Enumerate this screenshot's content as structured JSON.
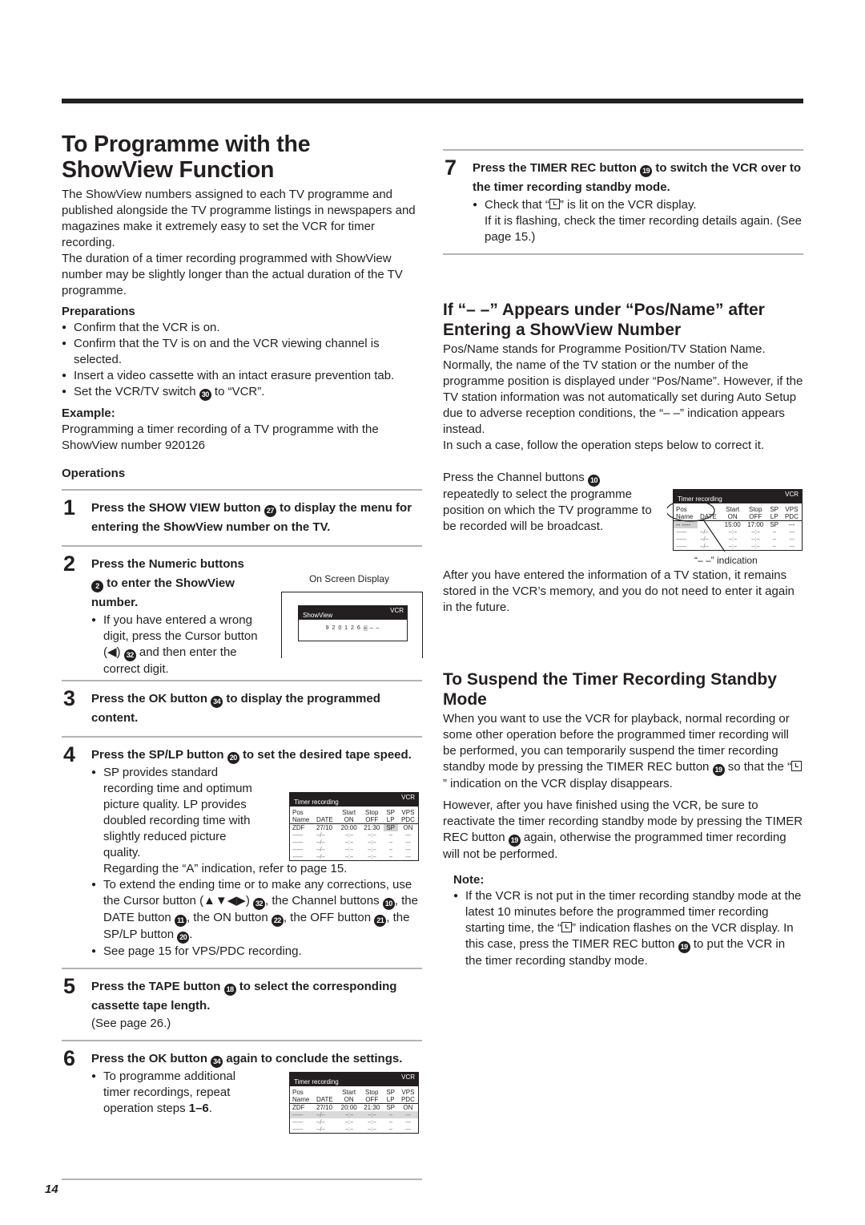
{
  "page_number": "14",
  "left": {
    "title_line1": "To Programme with the",
    "title_line2": "ShowView Function",
    "intro1": "The ShowView numbers assigned to each TV programme and published alongside the TV programme listings in newspapers and magazines make it extremely easy to set the VCR for timer recording.",
    "intro2": "The duration of a timer recording programmed with ShowView number may be slightly longer than the actual duration of the TV programme.",
    "preparations_heading": "Preparations",
    "preparations": [
      "Confirm that the VCR is on.",
      "Confirm that the TV is on and the VCR viewing channel is selected.",
      "Insert a video cassette with an intact erasure prevention tab.",
      "Set the VCR/TV switch",
      "to “VCR”."
    ],
    "prep_switch_ref": "30",
    "example_heading": "Example:",
    "example_text": "Programming a timer recording of a TV programme with the ShowView number 920126",
    "operations_heading": "Operations",
    "steps": [
      {
        "num": "1",
        "a": "Press the SHOW VIEW button",
        "ref": "27",
        "b": "to display the menu for entering the ShowView number on the TV."
      },
      {
        "num": "2",
        "a": "Press the Numeric buttons",
        "ref": "2",
        "b": "to enter the ShowView number.",
        "bullet_a": "If you have entered a wrong digit, press the Cursor button (◀)",
        "bullet_ref": "32",
        "bullet_b": "and then enter the correct digit."
      },
      {
        "num": "3",
        "a": "Press the OK button",
        "ref": "34",
        "b": "to display the programmed content."
      },
      {
        "num": "4",
        "a": "Press the SP/LP button",
        "ref": "20",
        "b": "to set the desired tape speed.",
        "bullet1": "SP provides standard recording time and optimum picture quality. LP provides doubled recording time with slightly reduced picture quality.",
        "bullet1_extra": "Regarding the “A” indication, refer to page 15.",
        "bullet2_parts": [
          "To extend the ending time or to make any corrections, use the Cursor button (▲▼◀▶)",
          ", the Channel buttons",
          ", the DATE button",
          ", the ON button",
          ", the OFF button",
          ", the SP/LP button",
          "."
        ],
        "bullet2_refs": [
          "32",
          "10",
          "11",
          "22",
          "21",
          "20"
        ],
        "bullet3": "See page 15 for VPS/PDC recording."
      },
      {
        "num": "5",
        "a": "Press the TAPE button",
        "ref": "18",
        "b": "to select the corresponding cassette tape length.",
        "extra": "(See page 26.)"
      },
      {
        "num": "6",
        "a": "Press the OK button",
        "ref": "34",
        "b": "again to conclude the settings.",
        "bullet_a": "To programme additional timer recordings, repeat operation steps",
        "bullet_bold": "1–6",
        "bullet_b": "."
      }
    ]
  },
  "osd_showview": {
    "caption": "On Screen Display",
    "title": "ShowView",
    "source": "VCR",
    "digits": "9 2 0 1 2 6",
    "cursor": "–",
    "rest": "– –"
  },
  "timer_table_header": {
    "title": "Timer recording",
    "source": "VCR",
    "head1": [
      "Pos",
      "",
      "Start",
      "Stop",
      "SP",
      "VPS"
    ],
    "head2": [
      "Name",
      "DATE",
      "ON",
      "OFF",
      "LP",
      "PDC"
    ]
  },
  "timer_table_step4": {
    "rows": [
      [
        "ZDF",
        "27/10",
        "20:00",
        "21:30",
        "SP",
        "ON"
      ],
      [
        "------",
        "--/--",
        "--:--",
        "--:--",
        "--",
        "---"
      ],
      [
        "------",
        "--/--",
        "--:--",
        "--:--",
        "--",
        "---"
      ],
      [
        "------",
        "--/--",
        "--:--",
        "--:--",
        "--",
        "---"
      ],
      [
        "------",
        "--/--",
        "--:--",
        "--:--",
        "--",
        "---"
      ]
    ]
  },
  "timer_table_step6": {
    "rows": [
      [
        "ZDF",
        "27/10",
        "20:00",
        "21:30",
        "SP",
        "ON"
      ],
      [
        "------",
        "--/--",
        "--:--",
        "--:--",
        "--",
        "---"
      ],
      [
        "------",
        "--/--",
        "--:--",
        "--:--",
        "--",
        "---"
      ],
      [
        "------",
        "--/--",
        "--:--",
        "--:--",
        "--",
        "---"
      ]
    ]
  },
  "timer_table_posname": {
    "rows": [
      [
        "-- ----",
        "",
        "15:00",
        "17:00",
        "SP",
        "---"
      ],
      [
        "------",
        "--/--",
        "--:--",
        "--:--",
        "--",
        "---"
      ],
      [
        "------",
        "--/--",
        "--:--",
        "--:--",
        "--",
        "---"
      ],
      [
        "------",
        "--/--",
        "--:--",
        "--:--",
        "--",
        "---"
      ]
    ],
    "callout": "“– –” indication"
  },
  "right": {
    "step7": {
      "num": "7",
      "a": "Press the TIMER REC button",
      "ref": "19",
      "b": "to switch the VCR over to the timer recording standby mode.",
      "bullet_a": "Check that “",
      "bullet_b": "” is lit on the VCR display.",
      "bullet_extra": "If it is flashing, check the timer recording details again. (See page 15.)"
    },
    "posname_heading": "If “– –” Appears under “Pos/Name” after Entering a ShowView Number",
    "posname_body": "Pos/Name stands for Programme Position/TV Station Name. Normally, the name of the TV station or the number of the programme position is displayed under “Pos/Name”. However, if the TV station information was not automatically set during Auto Setup due to adverse reception conditions, the “– –” indication appears instead.",
    "posname_body2": "In such a case, follow the operation steps below to correct it.",
    "channel_a": "Press the Channel buttons",
    "channel_ref": "10",
    "channel_b": "repeatedly to select the programme position on which the TV programme to be recorded will be broadcast.",
    "after_text": "After you have entered the information of a TV station, it remains stored in the VCR’s memory, and you do not need to enter it again in the future.",
    "suspend_heading": "To Suspend the Timer Recording Standby Mode",
    "suspend_a": "When you want to use the VCR for playback, normal recording or some other operation before the programmed timer recording will be performed, you can temporarily suspend the timer recording standby mode by pressing the TIMER REC button",
    "suspend_ref": "19",
    "suspend_b": "so that the “",
    "suspend_c": "” indication on the VCR display disappears.",
    "reactivate_a": "However, after you have finished using the VCR, be sure to reactivate the timer recording standby mode by pressing the TIMER REC button",
    "reactivate_ref": "19",
    "reactivate_b": "again, otherwise the programmed timer recording will not be performed.",
    "note_heading": "Note:",
    "note_a": "If the VCR is not put in the timer recording standby mode at the latest 10 minutes before the programmed timer recording starting time, the “",
    "note_b": "” indication flashes on the VCR display. In this case, press the TIMER REC button",
    "note_ref": "19",
    "note_c": "to put the VCR in the timer recording standby mode."
  }
}
